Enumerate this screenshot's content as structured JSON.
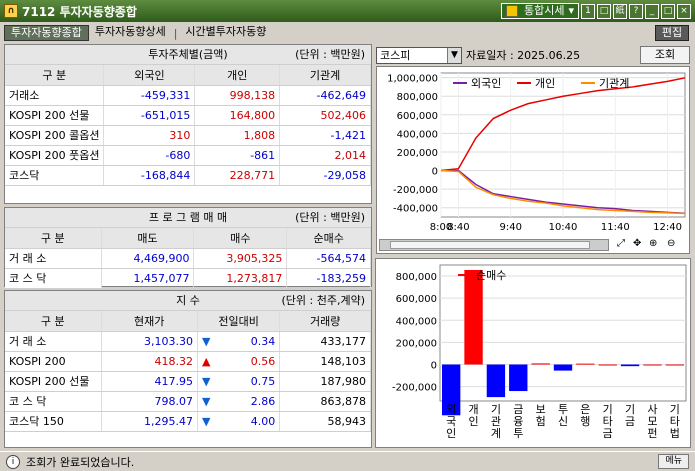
{
  "window": {
    "title": "7112 투자자동향종합",
    "combo_label": "통합시세",
    "buttons": [
      "1",
      "□",
      "紙",
      "?",
      "_",
      "□",
      "×"
    ]
  },
  "tabs": [
    {
      "label": "투자자동향종합",
      "active": true
    },
    {
      "label": "투자자동향상세",
      "active": false
    },
    {
      "label": "시간별투자자동향",
      "active": false
    }
  ],
  "edit_label": "편집",
  "investor": {
    "title": "투자주체별(금액)",
    "unit": "(단위 : 백만원)",
    "headers": [
      "구  분",
      "외국인",
      "개인",
      "기관계"
    ],
    "rows": [
      {
        "label": "거래소",
        "v": [
          "-459,331",
          "998,138",
          "-462,649"
        ]
      },
      {
        "label": "KOSPI 200 선물",
        "v": [
          "-651,015",
          "164,800",
          "502,406"
        ]
      },
      {
        "label": "KOSPI 200 콜옵션",
        "v": [
          "310",
          "1,808",
          "-1,421"
        ]
      },
      {
        "label": "KOSPI 200 풋옵션",
        "v": [
          "-680",
          "-861",
          "2,014"
        ]
      },
      {
        "label": "코스닥",
        "v": [
          "-168,844",
          "228,771",
          "-29,058"
        ]
      }
    ]
  },
  "program": {
    "title": "프 로 그 램 매 매",
    "unit": "(단위 : 백만원)",
    "headers": [
      "구  분",
      "매도",
      "매수",
      "순매수"
    ],
    "rows": [
      {
        "label": "거 래 소",
        "v": [
          "4,469,900",
          "3,905,325",
          "-564,574"
        ]
      },
      {
        "label": "코 스 닥",
        "v": [
          "1,457,077",
          "1,273,817",
          "-183,259"
        ]
      }
    ]
  },
  "index": {
    "title": "지  수",
    "unit": "(단위 : 천주,계약)",
    "headers": [
      "구  분",
      "현재가",
      "전일대비",
      "거래량"
    ],
    "rows": [
      {
        "label": "거 래 소",
        "price": "3,103.30",
        "dir": "down",
        "chg": "0.34",
        "vol": "433,177"
      },
      {
        "label": "KOSPI 200",
        "price": "418.32",
        "dir": "up",
        "chg": "0.56",
        "vol": "148,103"
      },
      {
        "label": "KOSPI 200 선물",
        "price": "417.95",
        "dir": "down",
        "chg": "0.75",
        "vol": "187,980"
      },
      {
        "label": "코 스 닥",
        "price": "798.07",
        "dir": "down",
        "chg": "2.86",
        "vol": "863,878"
      },
      {
        "label": "코스닥 150",
        "price": "1,295.47",
        "dir": "down",
        "chg": "4.00",
        "vol": "58,943"
      }
    ]
  },
  "chart_controls": {
    "market": "코스피",
    "date_label": "자료일자 : 2025.06.25",
    "query_button": "조회"
  },
  "colors": {
    "foreign": "#7a1fa2",
    "individual": "#e60000",
    "institution": "#ff8c00",
    "bar_pos": "#ff0000",
    "bar_neg": "#0000ff"
  },
  "chart_data": [
    {
      "type": "line",
      "x": [
        "8:00",
        "8:40",
        "9:00",
        "9:20",
        "9:40",
        "10:00",
        "10:20",
        "10:40",
        "11:00",
        "11:20",
        "11:40",
        "12:00",
        "12:20",
        "12:40",
        "12:50"
      ],
      "xticks": [
        "8:00",
        "8:40",
        "9:40",
        "10:40",
        "11:40",
        "12:40"
      ],
      "yticks": [
        "1,000,000",
        "800,000",
        "600,000",
        "400,000",
        "200,000",
        "0",
        "-200,000",
        "-400,000"
      ],
      "ylim": [
        -500000,
        1050000
      ],
      "series": [
        {
          "name": "외국인",
          "values": [
            0,
            0,
            -150000,
            -250000,
            -280000,
            -310000,
            -340000,
            -360000,
            -380000,
            -400000,
            -410000,
            -430000,
            -440000,
            -450000,
            -459331
          ]
        },
        {
          "name": "개인",
          "values": [
            0,
            20000,
            350000,
            560000,
            650000,
            720000,
            760000,
            800000,
            830000,
            860000,
            880000,
            900000,
            930000,
            960000,
            998138
          ]
        },
        {
          "name": "기관계",
          "values": [
            0,
            -10000,
            -180000,
            -260000,
            -300000,
            -330000,
            -350000,
            -380000,
            -400000,
            -420000,
            -430000,
            -440000,
            -450000,
            -455000,
            -462649
          ]
        }
      ]
    },
    {
      "type": "bar",
      "legend": "순매수",
      "categories": [
        "외국인",
        "개인",
        "기관계",
        "금융투",
        "보험",
        "투신",
        "은행",
        "기타금",
        "기금",
        "사모펀",
        "기타법"
      ],
      "values": [
        -459331,
        855000,
        -295000,
        -240000,
        10000,
        -55000,
        8000,
        0,
        -15000,
        0,
        0
      ],
      "yticks": [
        "800,000",
        "600,000",
        "400,000",
        "200,000",
        "0",
        "-200,000"
      ],
      "ylim": [
        -330000,
        900000
      ]
    }
  ],
  "status": {
    "message": "조회가 완료되었습니다.",
    "menu": "메뉴"
  }
}
